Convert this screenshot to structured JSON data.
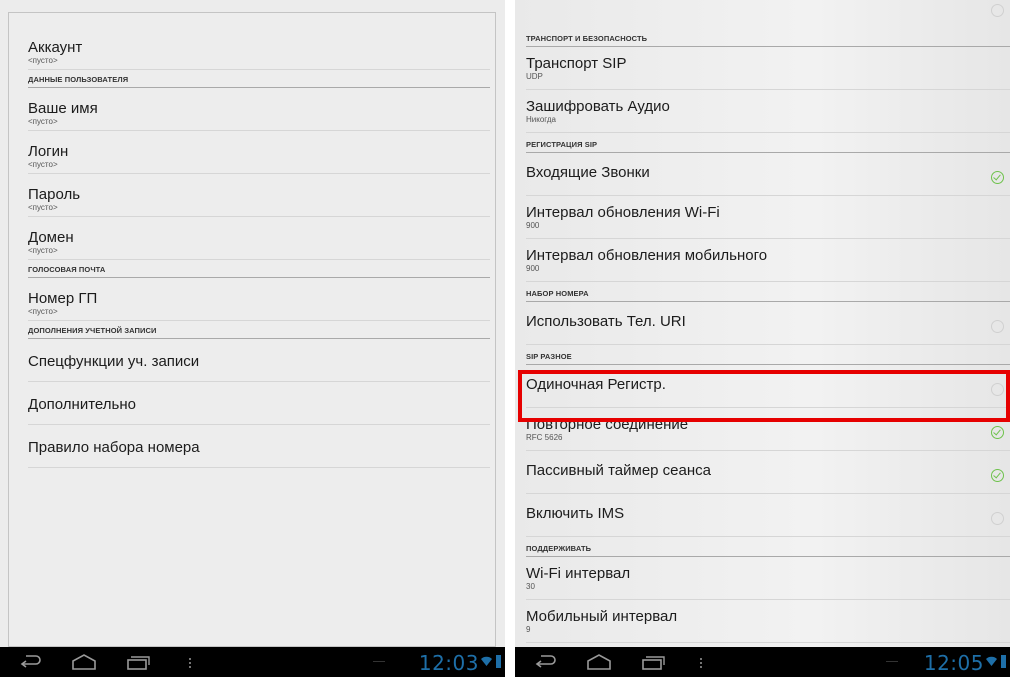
{
  "left": {
    "rows": [
      {
        "kind": "row",
        "title": "Аккаунт",
        "sub": "<пусто>"
      },
      {
        "kind": "header",
        "title": "ДАННЫЕ ПОЛЬЗОВАТЕЛЯ"
      },
      {
        "kind": "row",
        "title": "Ваше имя",
        "sub": "<пусто>"
      },
      {
        "kind": "row",
        "title": "Логин",
        "sub": "<пусто>"
      },
      {
        "kind": "row",
        "title": "Пароль",
        "sub": "<пусто>"
      },
      {
        "kind": "row",
        "title": "Домен",
        "sub": "<пусто>"
      },
      {
        "kind": "header",
        "title": "ГОЛОСОВАЯ ПОЧТА"
      },
      {
        "kind": "row",
        "title": "Номер ГП",
        "sub": "<пусто>"
      },
      {
        "kind": "header",
        "title": "ДОПОЛНЕНИЯ УЧЕТНОЙ ЗАПИСИ"
      },
      {
        "kind": "row",
        "title": "Спецфункции уч. записи"
      },
      {
        "kind": "row",
        "title": "Дополнительно"
      },
      {
        "kind": "row",
        "title": "Правило набора номера"
      }
    ],
    "clock": "12:03"
  },
  "right": {
    "rows": [
      {
        "kind": "header",
        "title": "ТРАНСПОРТ И БЕЗОПАСНОСТЬ"
      },
      {
        "kind": "row",
        "title": "Транспорт SIP",
        "sub": "UDP"
      },
      {
        "kind": "row",
        "title": "Зашифровать Аудио",
        "sub": "Никогда"
      },
      {
        "kind": "header",
        "title": "РЕГИСТРАЦИЯ SIP"
      },
      {
        "kind": "row",
        "title": "Входящие Звонки",
        "check": "on"
      },
      {
        "kind": "row",
        "title": "Интервал обновления Wi-Fi",
        "sub": "900"
      },
      {
        "kind": "row",
        "title": "Интервал обновления мобильного",
        "sub": "900"
      },
      {
        "kind": "header",
        "title": "НАБОР НОМЕРА"
      },
      {
        "kind": "row",
        "title": "Использовать Тел. URI",
        "check": "off"
      },
      {
        "kind": "header",
        "title": "SIP РАЗНОЕ"
      },
      {
        "kind": "row",
        "title": "Одиночная Регистр.",
        "check": "off"
      },
      {
        "kind": "row",
        "title": "Повторное соединение",
        "sub": "RFC 5626",
        "check": "on"
      },
      {
        "kind": "row",
        "title": "Пассивный таймер сеанса",
        "check": "on"
      },
      {
        "kind": "row",
        "title": "Включить IMS",
        "check": "off"
      },
      {
        "kind": "header",
        "title": "ПОДДЕРЖИВАТЬ"
      },
      {
        "kind": "row",
        "title": "Wi-Fi интервал",
        "sub": "30"
      },
      {
        "kind": "row",
        "title": "Мобильный интервал",
        "sub": "9"
      }
    ],
    "clock": "12:05"
  },
  "icons": {
    "back": "back-arrow-icon",
    "home": "home-icon",
    "recents": "recent-apps-icon",
    "menu": "menu-dots-icon",
    "wifi": "wifi-icon",
    "battery": "battery-icon",
    "check_on": "checkbox-checked-icon",
    "check_off": "checkbox-unchecked-icon"
  },
  "colors": {
    "accent": "#1e6fa8",
    "check": "#6ec24c",
    "highlight": "#e60000",
    "navbar": "#000000"
  }
}
